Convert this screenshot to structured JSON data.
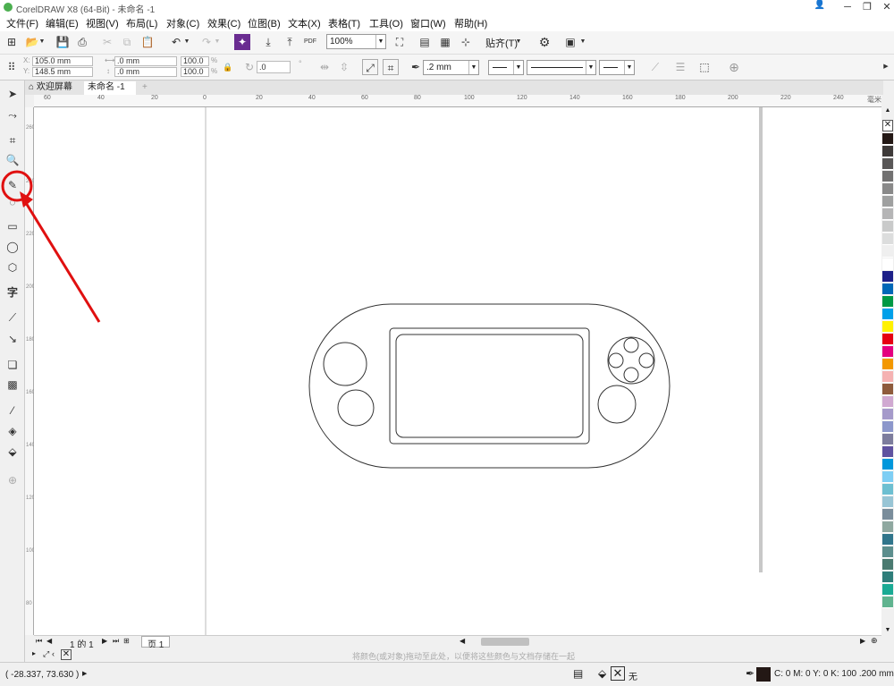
{
  "window": {
    "title": "CorelDRAW X8 (64-Bit) - 未命名 -1"
  },
  "menu": [
    "文件(F)",
    "编辑(E)",
    "视图(V)",
    "布局(L)",
    "对象(C)",
    "效果(C)",
    "位图(B)",
    "文本(X)",
    "表格(T)",
    "工具(O)",
    "窗口(W)",
    "帮助(H)"
  ],
  "toolbar1": {
    "zoom": "100%",
    "snap": "贴齐(T)",
    "pdf": "PDF"
  },
  "toolbar2": {
    "x": "105.0 mm",
    "y": "148.5 mm",
    "w": ".0 mm",
    "h": ".0 mm",
    "sx": "100.0",
    "sy": "100.0",
    "pct": "%",
    "angle": ".0",
    "outline": ".2 mm"
  },
  "tabs": {
    "welcome": "欢迎屏幕",
    "doc": "未命名 -1",
    "add": "+"
  },
  "ruler": {
    "h": [
      "60",
      "40",
      "20",
      "0",
      "20",
      "40",
      "60",
      "80",
      "100",
      "120",
      "140",
      "160",
      "180",
      "200",
      "220",
      "240"
    ],
    "unit": "毫米",
    "v": [
      "260",
      "240",
      "220",
      "200",
      "180",
      "160",
      "140",
      "120",
      "100",
      "80"
    ]
  },
  "pagebar": {
    "counter": "1 的 1",
    "page": "页 1"
  },
  "hint": "将颜色(或对象)拖动至此处，以便将这些颜色与文档存储在一起",
  "status": {
    "coords": "( -28.337, 73.630 )",
    "fill_none": "无",
    "color": "C: 0 M: 0 Y: 0 K: 100  .200 mm"
  },
  "palette": [
    "#231815",
    "#3e3a39",
    "#595757",
    "#727171",
    "#898989",
    "#9fa0a0",
    "#b5b5b6",
    "#c9caca",
    "#dcdddd",
    "#efefef",
    "#ffffff",
    "#1d2088",
    "#0068b7",
    "#009944",
    "#00a0e9",
    "#fff100",
    "#e60012",
    "#e4007f",
    "#f39800",
    "#f5b2b2",
    "#8e5b3c",
    "#d0a9d1",
    "#a59aca",
    "#8c97cb",
    "#7d7d9d",
    "#5f52a0",
    "#0097db",
    "#7ecef4",
    "#6dbfd1",
    "#98c5d5",
    "#7a8d9b",
    "#8fa8a0",
    "#30758b",
    "#5c8e8d",
    "#4a7a70",
    "#2e7d7a",
    "#1aaa94",
    "#60b38f"
  ]
}
